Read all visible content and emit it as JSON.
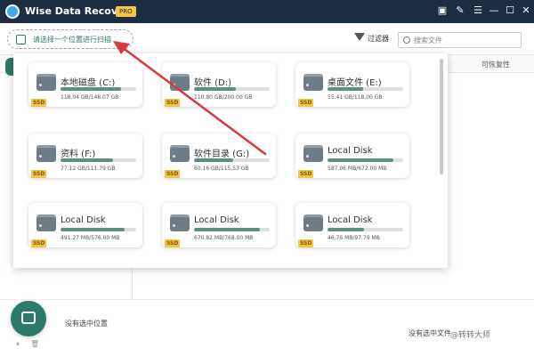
{
  "window": {
    "title": "Wise Data Recovery",
    "badge": "PRO",
    "controls": [
      "▣",
      "✎",
      "☰",
      "—",
      "☐",
      "✕"
    ]
  },
  "toolbar": {
    "location_label": "请选择一个位置进行扫描",
    "filter_label": "过滤器",
    "search_placeholder": "搜索文件"
  },
  "list": {
    "col_recoverable": "可恢复性"
  },
  "drives": [
    {
      "name": "本地磁盘 (C:)",
      "size": "118.04 GB/148.07 GB",
      "used": 0.8,
      "ssd": "SSD",
      "icon": "hard-drive-icon"
    },
    {
      "name": "软件 (D:)",
      "size": "110.80 GB/200.00 GB",
      "used": 0.55,
      "ssd": "SSD",
      "icon": "hard-drive-icon"
    },
    {
      "name": "桌面文件 (E:)",
      "size": "55.41 GB/118.00 GB",
      "used": 0.47,
      "ssd": "SSD",
      "icon": "hard-drive-icon"
    },
    {
      "name": "资料 (F:)",
      "size": "77.12 GB/111.79 GB",
      "used": 0.69,
      "ssd": "SSD",
      "icon": "hard-drive-icon"
    },
    {
      "name": "软件目录 (G:)",
      "size": "60.16 GB/115.53 GB",
      "used": 0.52,
      "ssd": "SSD",
      "icon": "hard-drive-icon"
    },
    {
      "name": "Local Disk",
      "size": "587.06 MB/672.00 MB",
      "used": 0.87,
      "ssd": "SSD",
      "icon": "hard-drive-icon"
    },
    {
      "name": "Local Disk",
      "size": "491.27 MB/576.00 MB",
      "used": 0.85,
      "ssd": "SSD",
      "icon": "hard-drive-icon"
    },
    {
      "name": "Local Disk",
      "size": "670.82 MB/768.00 MB",
      "used": 0.87,
      "ssd": "SSD",
      "icon": "hard-drive-icon"
    },
    {
      "name": "Local Disk",
      "size": "46.76 MB/97.79 MB",
      "used": 0.48,
      "ssd": "SSD",
      "icon": "hard-drive-icon"
    }
  ],
  "bottom": {
    "no_location": "没有选中位置",
    "no_file": "没有选中文件",
    "watermark": "@转转大师"
  },
  "colors": {
    "titlebar": "#1d2d42",
    "accent": "#2c7a6b",
    "progress": "#5f8f82",
    "arrow": "#d63a3a"
  }
}
